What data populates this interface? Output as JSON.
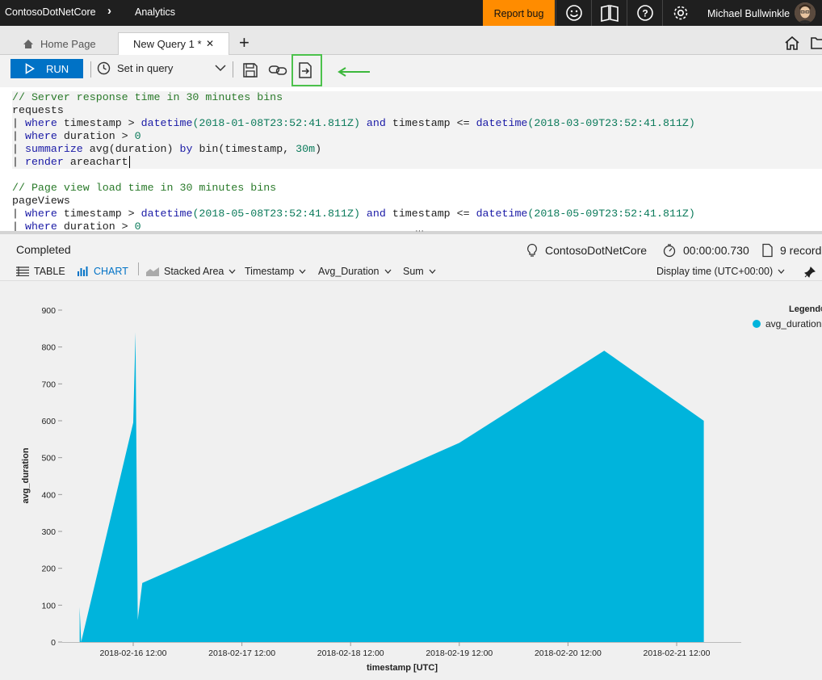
{
  "topbar": {
    "app_name": "ContosoDotNetCore",
    "section": "Analytics",
    "report_bug": "Report bug",
    "user_name": "Michael Bullwinkle",
    "icons": [
      "smiley-icon",
      "book-icon",
      "help-icon",
      "gear-icon"
    ]
  },
  "tabs": {
    "home": "Home Page",
    "active": "New Query 1 *",
    "add": "+"
  },
  "toolbar": {
    "run_label": "RUN",
    "time_range": "Set in query"
  },
  "editor": {
    "lines": [
      [
        {
          "t": "// Server response time in 30 minutes bins",
          "c": "cmt"
        }
      ],
      [
        {
          "t": "requests",
          "c": ""
        }
      ],
      [
        {
          "t": "| ",
          "c": ""
        },
        {
          "t": "where",
          "c": "kw"
        },
        {
          "t": " timestamp > ",
          "c": ""
        },
        {
          "t": "datetime",
          "c": "fn"
        },
        {
          "t": "(2018-01-08T23:52:41.811Z)",
          "c": "num"
        },
        {
          "t": " ",
          "c": ""
        },
        {
          "t": "and",
          "c": "kw"
        },
        {
          "t": " timestamp <= ",
          "c": ""
        },
        {
          "t": "datetime",
          "c": "fn"
        },
        {
          "t": "(2018-03-09T23:52:41.811Z)",
          "c": "num"
        }
      ],
      [
        {
          "t": "| ",
          "c": ""
        },
        {
          "t": "where",
          "c": "kw"
        },
        {
          "t": " duration > ",
          "c": ""
        },
        {
          "t": "0",
          "c": "num"
        }
      ],
      [
        {
          "t": "| ",
          "c": ""
        },
        {
          "t": "summarize",
          "c": "kw"
        },
        {
          "t": " avg(duration) ",
          "c": ""
        },
        {
          "t": "by",
          "c": "kw"
        },
        {
          "t": " bin(timestamp, ",
          "c": ""
        },
        {
          "t": "30m",
          "c": "num"
        },
        {
          "t": ")",
          "c": ""
        }
      ],
      [
        {
          "t": "| ",
          "c": ""
        },
        {
          "t": "render",
          "c": "kw"
        },
        {
          "t": " areachart",
          "c": ""
        }
      ],
      [
        {
          "t": "",
          "c": ""
        }
      ],
      [
        {
          "t": "// Page view load time in 30 minutes bins",
          "c": "cmt"
        }
      ],
      [
        {
          "t": "pageViews",
          "c": ""
        }
      ],
      [
        {
          "t": "| ",
          "c": ""
        },
        {
          "t": "where",
          "c": "kw"
        },
        {
          "t": " timestamp > ",
          "c": ""
        },
        {
          "t": "datetime",
          "c": "fn"
        },
        {
          "t": "(2018-05-08T23:52:41.811Z)",
          "c": "num"
        },
        {
          "t": " ",
          "c": ""
        },
        {
          "t": "and",
          "c": "kw"
        },
        {
          "t": " timestamp <= ",
          "c": ""
        },
        {
          "t": "datetime",
          "c": "fn"
        },
        {
          "t": "(2018-05-09T23:52:41.811Z)",
          "c": "num"
        }
      ],
      [
        {
          "t": "| ",
          "c": ""
        },
        {
          "t": "where",
          "c": "kw"
        },
        {
          "t": " duration > ",
          "c": ""
        },
        {
          "t": "0",
          "c": "num"
        }
      ]
    ]
  },
  "results": {
    "status": "Completed",
    "app": "ContosoDotNetCore",
    "elapsed": "00:00:00.730",
    "records": "9 record",
    "table_label": "TABLE",
    "chart_label": "CHART",
    "chart_type": "Stacked Area",
    "x_field": "Timestamp",
    "y_field": "Avg_Duration",
    "aggregation": "Sum",
    "display_time": "Display time (UTC+00:00)"
  },
  "colors": {
    "accent": "#0072c6",
    "series": "#00b4dc",
    "report_bug": "#ff8c00",
    "highlight": "#4cc24c"
  },
  "chart_data": {
    "type": "area",
    "x": [
      "2018-02-16 00:10",
      "2018-02-16 00:30",
      "2018-02-16 12:00",
      "2018-02-16 12:30",
      "2018-02-16 13:00",
      "2018-02-16 14:00",
      "2018-02-19 12:00",
      "2018-02-20 20:00",
      "2018-02-21 18:00"
    ],
    "series": [
      {
        "name": "avg_duration",
        "values": [
          95,
          0,
          595,
          840,
          60,
          160,
          540,
          790,
          600
        ]
      }
    ],
    "xlabel": "timestamp [UTC]",
    "ylabel": "avg_duration",
    "ylim": [
      0,
      900
    ],
    "yticks": [
      0,
      100,
      200,
      300,
      400,
      500,
      600,
      700,
      800,
      900
    ],
    "xticks": [
      "2018-02-16 12:00",
      "2018-02-17 12:00",
      "2018-02-18 12:00",
      "2018-02-19 12:00",
      "2018-02-20 12:00",
      "2018-02-21 12:00"
    ],
    "legend_title": "Legend",
    "legend_position": "top-right",
    "grid": false
  }
}
